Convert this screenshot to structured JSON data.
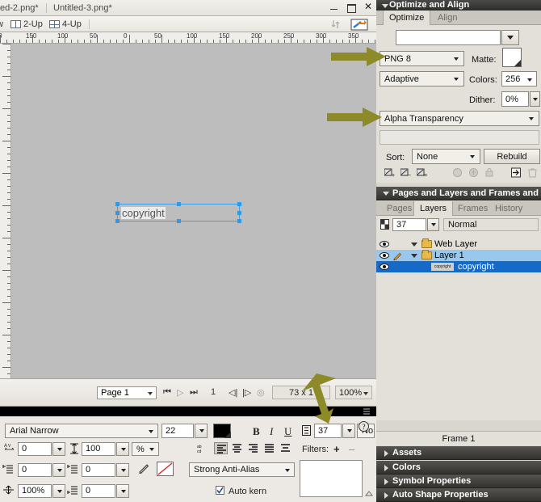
{
  "app": {
    "document_tabs": [
      {
        "label": "ed-2.png*"
      },
      {
        "label": "Untitled-3.png*"
      }
    ],
    "window_controls": {
      "minimize": "–",
      "maximize": "▣",
      "close": "✕"
    }
  },
  "viewbar": {
    "items": [
      {
        "label": "w",
        "icon": "preview-icon"
      },
      {
        "label": "2-Up",
        "icon": "two-up-icon"
      },
      {
        "label": "4-Up",
        "icon": "four-up-icon"
      }
    ],
    "sort_icon": "sort-updown-icon",
    "export_icon": "quick-export-icon"
  },
  "ruler": {
    "horizontal_labels": [
      "0",
      "150",
      "100",
      "50",
      "0",
      "50",
      "100",
      "150",
      "200",
      "250",
      "300",
      "350"
    ],
    "unit": "px"
  },
  "canvas": {
    "selected_object": {
      "text": "copyright",
      "name": "text-object"
    }
  },
  "statusbar": {
    "page_selector": "Page 1",
    "frame_number": "1",
    "dimensions": "73 x 1",
    "zoom": "100%"
  },
  "properties": {
    "font_family": "Arial Narrow",
    "font_size": "22",
    "color_swatch": "#000000",
    "bold": "B",
    "italic": "I",
    "underline": "U",
    "leading_value": "37",
    "leading_unit": "No",
    "help_icon": "help-icon",
    "kerning_value": "0",
    "horizontal_scale_value": "100",
    "horizontal_scale_unit": "%",
    "baseline_shift_value": "0",
    "paragraph_indent_value": "0",
    "paragraph_space_before": "100%",
    "paragraph_space_after": "0",
    "anti_alias": "Strong Anti-Alias",
    "auto_kern_label": "Auto kern",
    "auto_kern_checked": true,
    "filters_label": "Filters:",
    "filters_add": "+",
    "filters_remove": "–"
  },
  "right_panel": {
    "optimize_panel": {
      "title": "Optimize and Align",
      "tabs": [
        {
          "label": "Optimize",
          "active": true
        },
        {
          "label": "Align",
          "active": false
        }
      ],
      "saved_settings": "",
      "format": "PNG 8",
      "matte_label": "Matte:",
      "matte_color": "#ffffff",
      "palette": "Adaptive",
      "colors_label": "Colors:",
      "colors_value": "256",
      "dither_label": "Dither:",
      "dither_value": "0%",
      "transparency": "Alpha Transparency",
      "sort_label": "Sort:",
      "sort_value": "None",
      "rebuild_label": "Rebuild",
      "tool_icons": [
        "eyedropper-add-icon",
        "eyedropper-remove-icon",
        "eyedropper-edit-icon",
        "transparent-swatch-icon",
        "lock-swatch-icon",
        "lock-icon",
        "snap-to-websafe-icon",
        "delete-swatch-icon"
      ]
    },
    "layers_panel": {
      "title": "Pages and Layers and Frames and H",
      "tabs": [
        {
          "label": "Pages",
          "active": false
        },
        {
          "label": "Layers",
          "active": true
        },
        {
          "label": "Frames",
          "active": false
        },
        {
          "label": "History",
          "active": false
        }
      ],
      "opacity_value": "37",
      "blend_mode": "Normal",
      "rows": [
        {
          "name": "Web Layer",
          "type": "folder",
          "expanded": true,
          "selected": false,
          "visible": true,
          "locked": false
        },
        {
          "name": "Layer 1",
          "type": "folder",
          "expanded": true,
          "selected": true,
          "visible": true,
          "locked": false,
          "editable": true
        },
        {
          "name": "copyright",
          "type": "object",
          "selected": true,
          "visible": true,
          "thumbnail": "copyright"
        }
      ],
      "frame_label": "Frame 1"
    },
    "collapsed_sections": [
      {
        "label": "Assets"
      },
      {
        "label": "Colors"
      },
      {
        "label": "Symbol Properties"
      },
      {
        "label": "Auto Shape Properties"
      }
    ]
  },
  "annotations": {
    "arrow_color": "#8d8a2a",
    "arrows": [
      {
        "name": "arrow-to-format",
        "target": "PNG 8"
      },
      {
        "name": "arrow-to-transparency",
        "target": "Alpha Transparency"
      },
      {
        "name": "arrow-to-leading",
        "target": "37"
      }
    ]
  }
}
